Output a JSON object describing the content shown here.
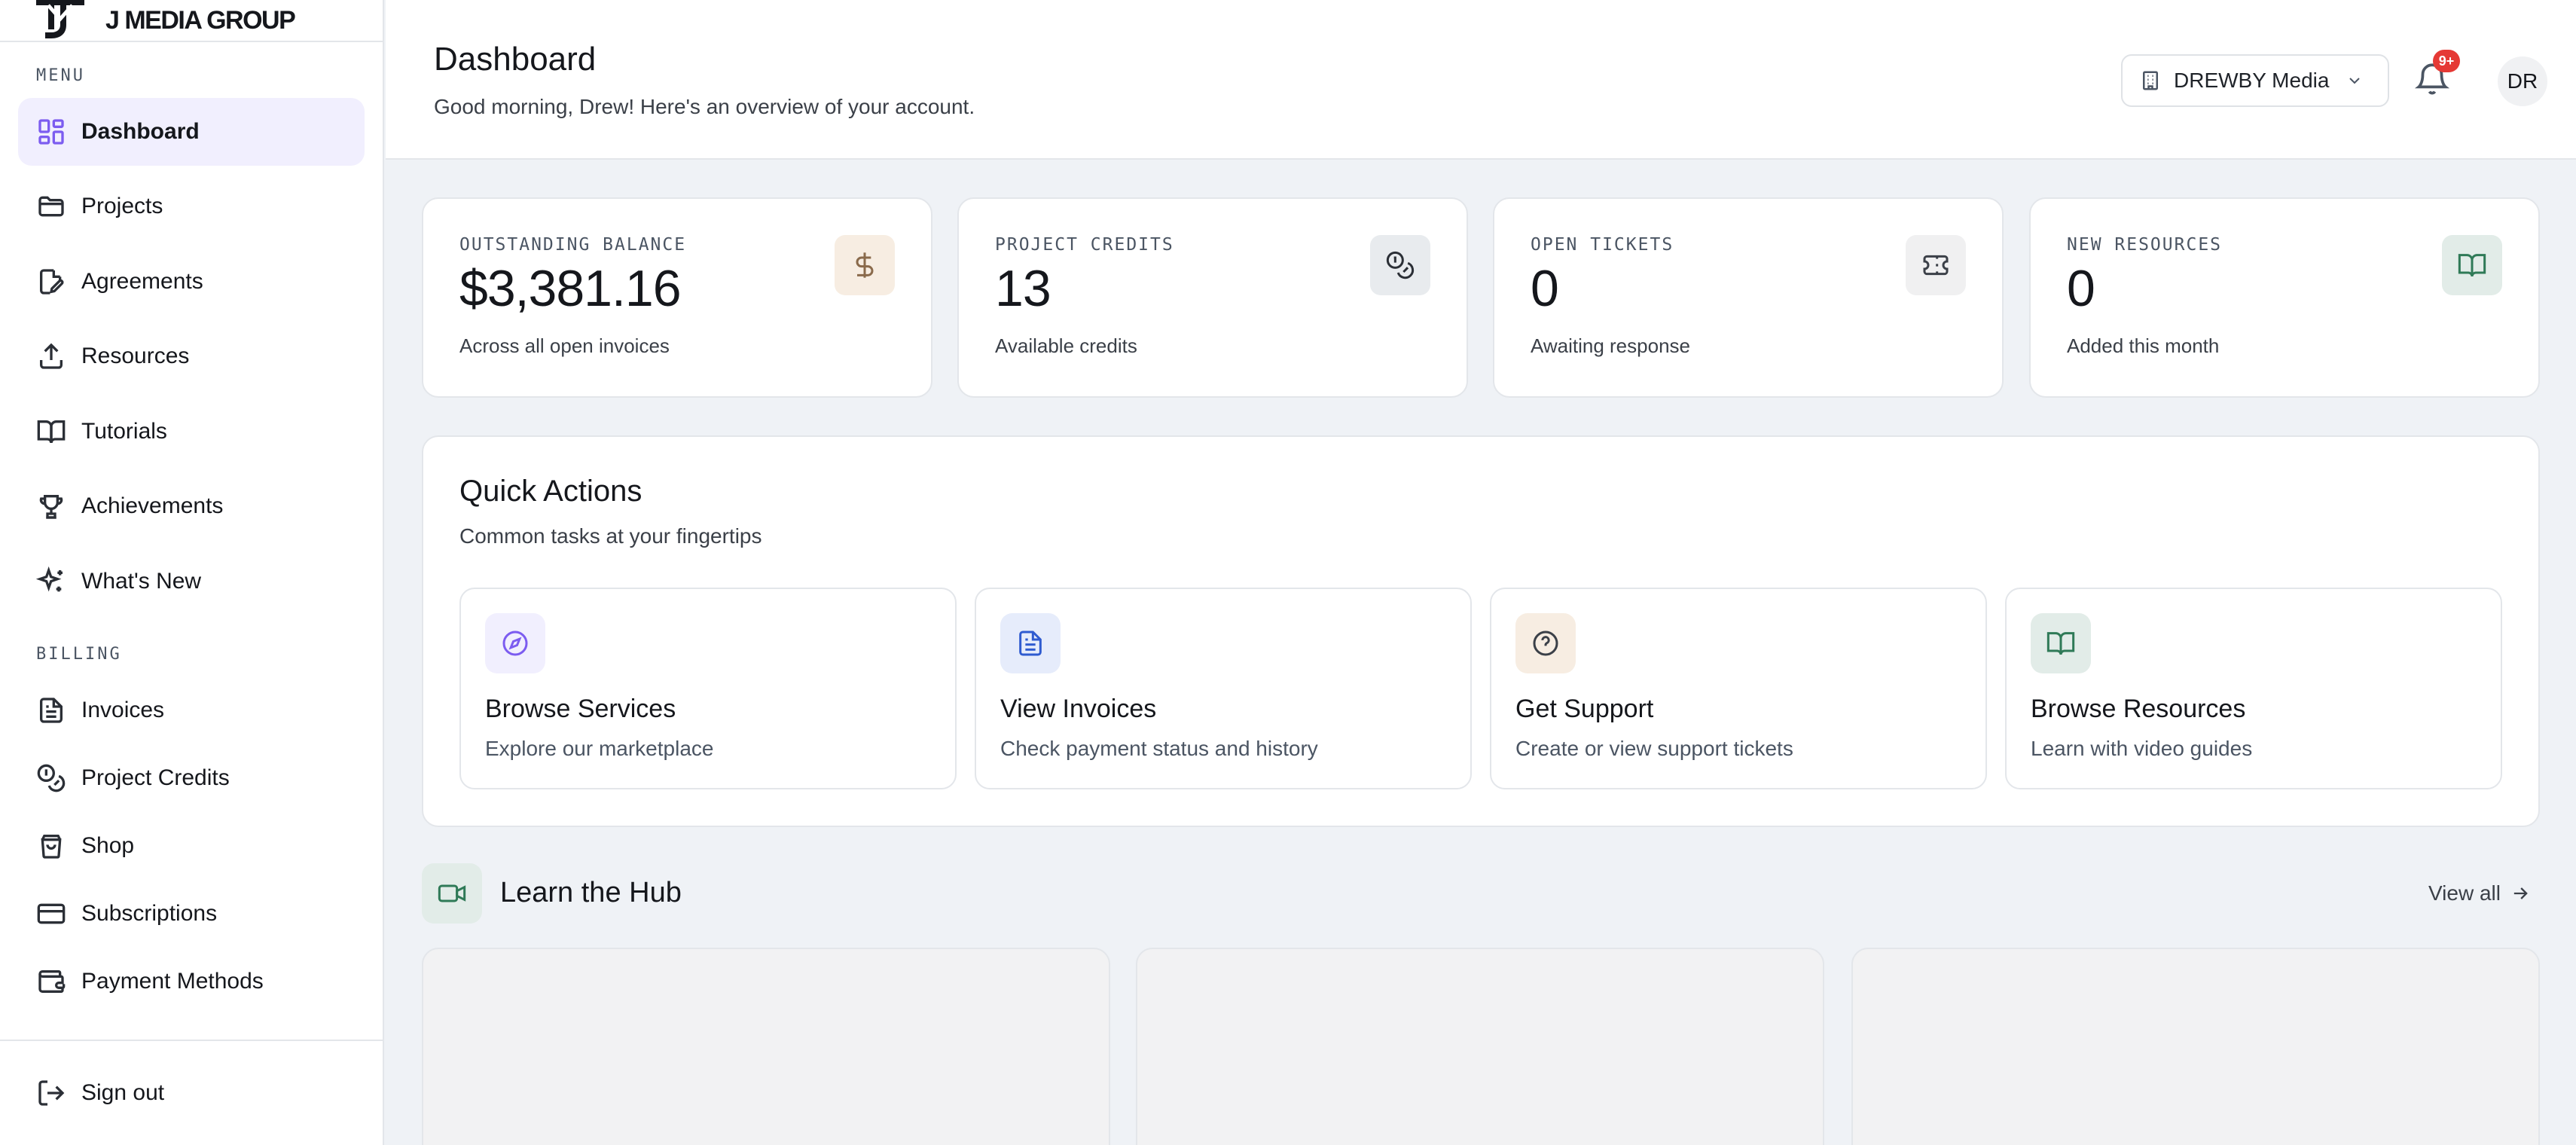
{
  "brand": {
    "name": "J MEDIA GROUP"
  },
  "sidebar": {
    "menu_label": "MENU",
    "billing_label": "BILLING",
    "menu_items": [
      {
        "label": "Dashboard",
        "icon": "dashboard-icon",
        "active": true
      },
      {
        "label": "Projects",
        "icon": "folder-icon"
      },
      {
        "label": "Agreements",
        "icon": "document-edit-icon"
      },
      {
        "label": "Resources",
        "icon": "upload-icon"
      },
      {
        "label": "Tutorials",
        "icon": "book-open-icon"
      },
      {
        "label": "Achievements",
        "icon": "trophy-icon"
      },
      {
        "label": "What's New",
        "icon": "sparkles-icon"
      }
    ],
    "billing_items": [
      {
        "label": "Invoices",
        "icon": "file-text-icon"
      },
      {
        "label": "Project Credits",
        "icon": "coins-icon"
      },
      {
        "label": "Shop",
        "icon": "shopping-bag-icon"
      },
      {
        "label": "Subscriptions",
        "icon": "credit-card-icon"
      },
      {
        "label": "Payment Methods",
        "icon": "wallet-icon"
      }
    ],
    "sign_out": "Sign out"
  },
  "header": {
    "title": "Dashboard",
    "subtitle": "Good morning, Drew! Here's an overview of your account.",
    "org_name": "DREWBY Media",
    "notification_count": "9+",
    "avatar_initials": "DR"
  },
  "stats": [
    {
      "label": "OUTSTANDING BALANCE",
      "value": "$3,381.16",
      "caption": "Across all open invoices",
      "icon": "dollar-icon"
    },
    {
      "label": "PROJECT CREDITS",
      "value": "13",
      "caption": "Available credits",
      "icon": "coins-icon"
    },
    {
      "label": "OPEN TICKETS",
      "value": "0",
      "caption": "Awaiting response",
      "icon": "ticket-icon"
    },
    {
      "label": "NEW RESOURCES",
      "value": "0",
      "caption": "Added this month",
      "icon": "book-open-icon"
    }
  ],
  "quick_actions": {
    "title": "Quick Actions",
    "subtitle": "Common tasks at your fingertips",
    "items": [
      {
        "title": "Browse Services",
        "desc": "Explore our marketplace",
        "icon": "compass-icon"
      },
      {
        "title": "View Invoices",
        "desc": "Check payment status and history",
        "icon": "file-text-icon"
      },
      {
        "title": "Get Support",
        "desc": "Create or view support tickets",
        "icon": "help-circle-icon"
      },
      {
        "title": "Browse Resources",
        "desc": "Learn with video guides",
        "icon": "book-open-icon"
      }
    ]
  },
  "hub": {
    "title": "Learn the Hub",
    "view_all": "View all"
  },
  "colors": {
    "accent": "#7c5cf0",
    "active_nav_bg": "#f1effe",
    "badge": "#e53935",
    "page_bg": "#eff2f6"
  }
}
